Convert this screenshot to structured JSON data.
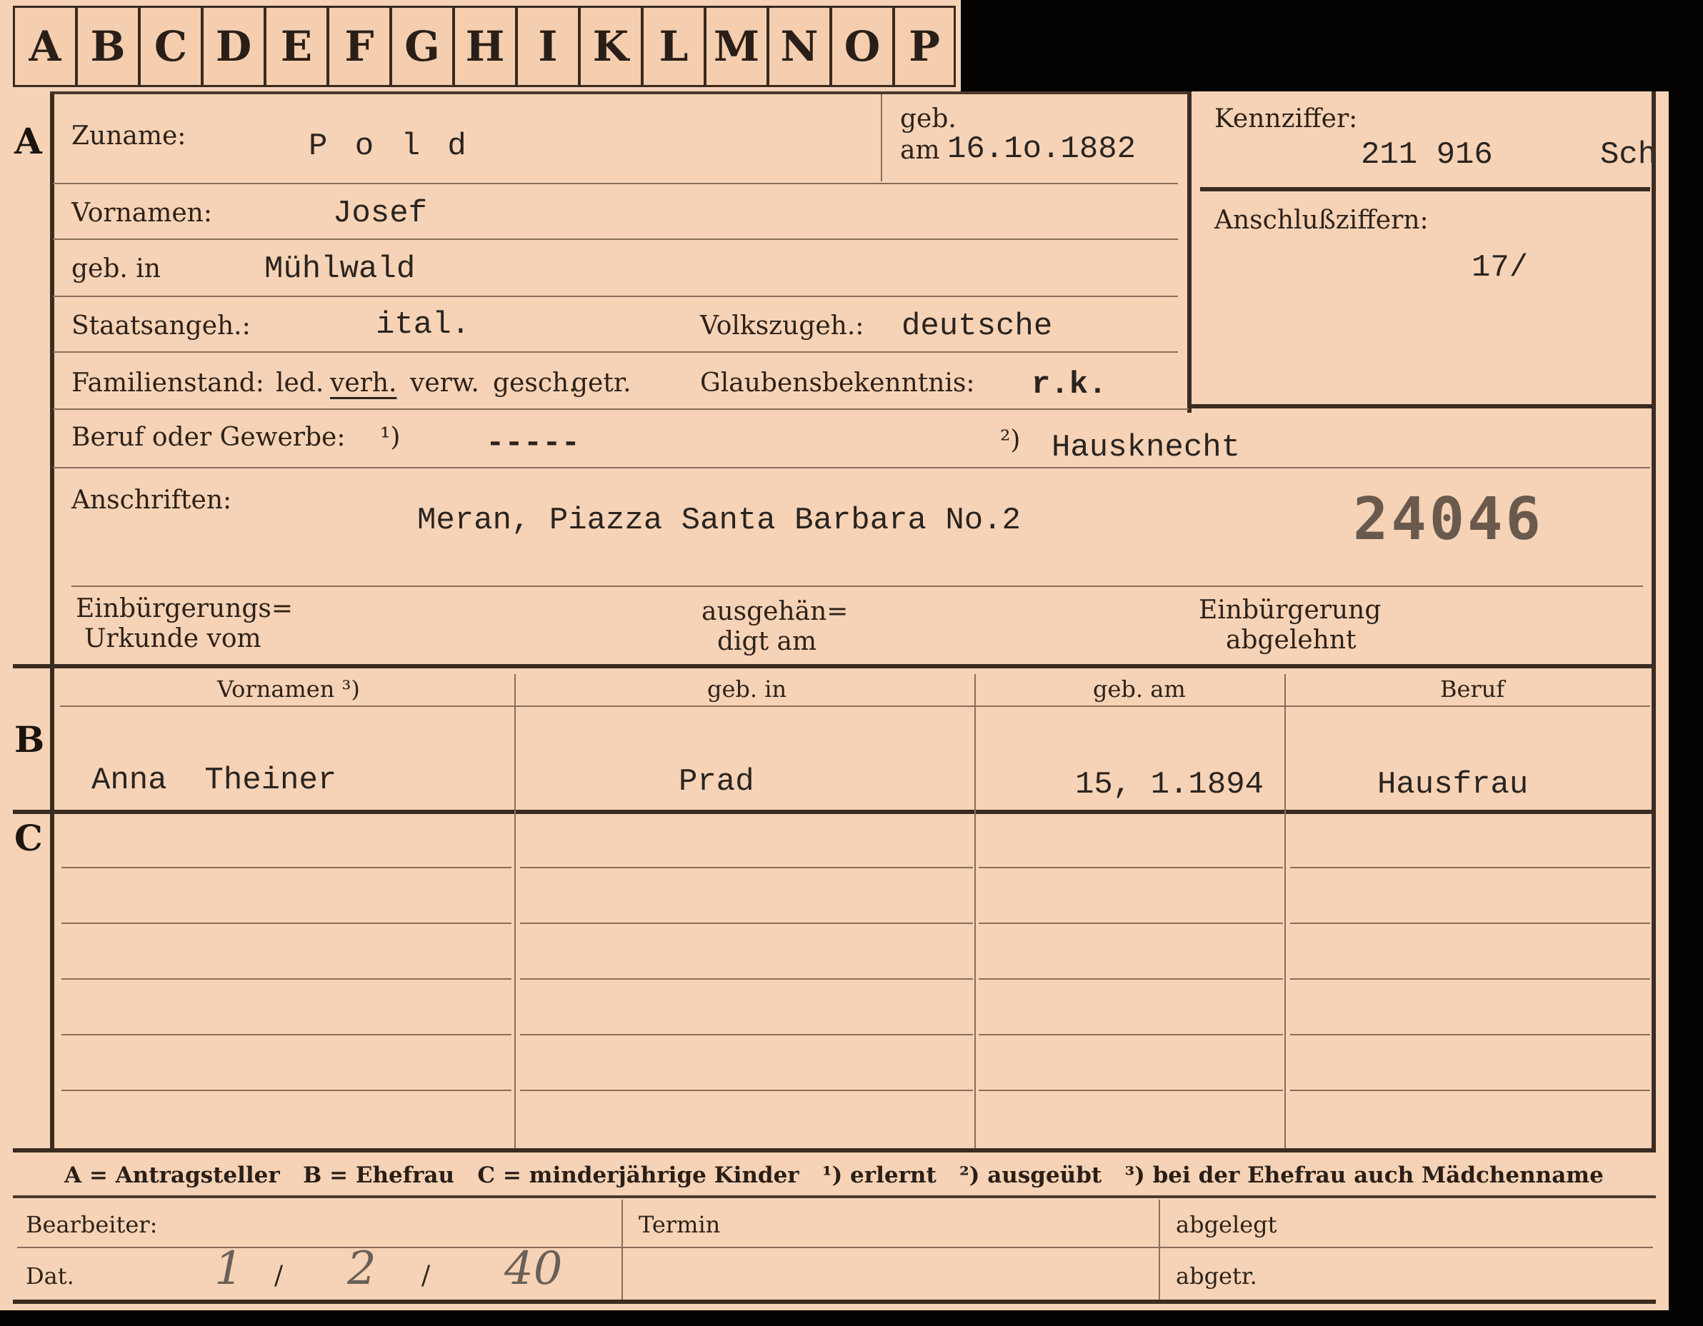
{
  "tabs": [
    "A",
    "B",
    "C",
    "D",
    "E",
    "F",
    "G",
    "H",
    "I",
    "K",
    "L",
    "M",
    "N",
    "O",
    "P"
  ],
  "section_a": {
    "letter": "A",
    "zuname_label": "Zuname:",
    "zuname_value": "P o l d",
    "geb_label": "geb.",
    "geb_am_label": "am",
    "geb_am_value": "16.1o.1882",
    "kennziffer_label": "Kennziffer:",
    "kennziffer_value": "211 916",
    "kennziffer_suffix": "Sch",
    "anschluss_label": "Anschlußziffern:",
    "anschluss_value": "17/",
    "vornamen_label": "Vornamen:",
    "vornamen_value": "Josef",
    "gebin_label": "geb. in",
    "gebin_value": "Mühlwald",
    "staat_label": "Staatsangeh.:",
    "staat_value": "ital.",
    "volks_label": "Volkszugeh.:",
    "volks_value": "deutsche",
    "familien_label": "Familienstand:",
    "familien_options": [
      "led.",
      "verh.",
      "verw.",
      "gesch.",
      "getr."
    ],
    "glauben_label": "Glaubensbekenntnis:",
    "glauben_value": "r.k.",
    "beruf_label": "Beruf oder Gewerbe:",
    "beruf_note1": "¹)",
    "beruf_value1": "-----",
    "beruf_note2": "²)",
    "beruf_value2": "Hausknecht",
    "anschriften_label": "Anschriften:",
    "anschriften_value": "Meran, Piazza Santa Barbara No.2",
    "stamp_number": "24046",
    "einb1_line1": "Einbürgerungs=",
    "einb1_line2": "Urkunde vom",
    "ausg_line1": "ausgehän=",
    "ausg_line2": "digt am",
    "einb2_line1": "Einbürgerung",
    "einb2_line2": "abgelehnt"
  },
  "section_b": {
    "letter": "B",
    "headers": [
      "Vornamen ³)",
      "geb. in",
      "geb. am",
      "Beruf"
    ],
    "row": [
      "Anna  Theiner",
      "Prad",
      "15, 1.1894",
      "Hausfrau"
    ]
  },
  "section_c": {
    "letter": "C"
  },
  "legend": "A = Antragsteller   B = Ehefrau   C = minderjährige Kinder   ¹) erlernt   ²) ausgeübt   ³) bei der Ehefrau auch Mädchenname",
  "footer": {
    "bearbeiter_label": "Bearbeiter:",
    "dat_label": "Dat.",
    "dat_day": "1",
    "dat_sep1": "/",
    "dat_month": "2",
    "dat_sep2": "/",
    "dat_year": "40",
    "termin_label": "Termin",
    "abgelegt_label": "abgelegt",
    "abgetr_label": "abgetr."
  }
}
